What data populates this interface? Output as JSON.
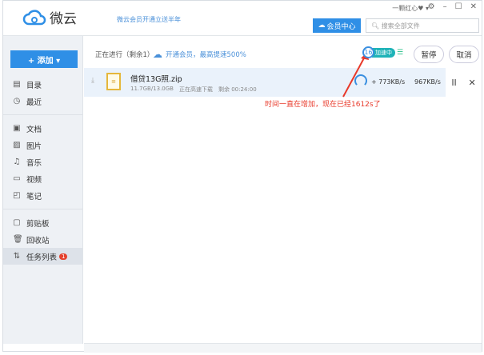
{
  "app": {
    "title": "微云",
    "promo": "微云会员开通立送半年",
    "account": "一颗红心♥ ▾",
    "vip_center": "会员中心",
    "search_placeholder": "搜索全部文件"
  },
  "window": {
    "settings": "⚙",
    "minimize": "–",
    "maximize": "☐",
    "close": "✕"
  },
  "sidebar": {
    "add_label": "+ 添加 ▾",
    "group1": [
      {
        "icon": "▤",
        "label": "目录"
      },
      {
        "icon": "◷",
        "label": "最近"
      }
    ],
    "group2": [
      {
        "icon": "▣",
        "label": "文档"
      },
      {
        "icon": "▨",
        "label": "图片"
      },
      {
        "icon": "♫",
        "label": "音乐"
      },
      {
        "icon": "▭",
        "label": "视频"
      },
      {
        "icon": "◰",
        "label": "笔记"
      }
    ],
    "group3": [
      {
        "icon": "▢",
        "label": "剪贴板"
      },
      {
        "icon": "🗑",
        "label": "回收站"
      },
      {
        "icon": "⇅",
        "label": "任务列表",
        "badge": "1"
      }
    ]
  },
  "main": {
    "progress": "正在进行（剩余1）",
    "vip_link": "开通会员，最高提速500%",
    "accel_num": "16",
    "accel_tag": "加速中",
    "pause_all": "暂停",
    "cancel_all": "取消",
    "task": {
      "name": "借贷13G照.zip",
      "size": "11.7GB/13.0GB",
      "status": "正在高速下载",
      "remaining": "剩余 00:24:00",
      "boost": "+ 773KB/s",
      "speed": "967KB/s",
      "pause": "II",
      "close": "✕"
    },
    "annotation": "时间一直在增加，现在已经1612s了"
  }
}
